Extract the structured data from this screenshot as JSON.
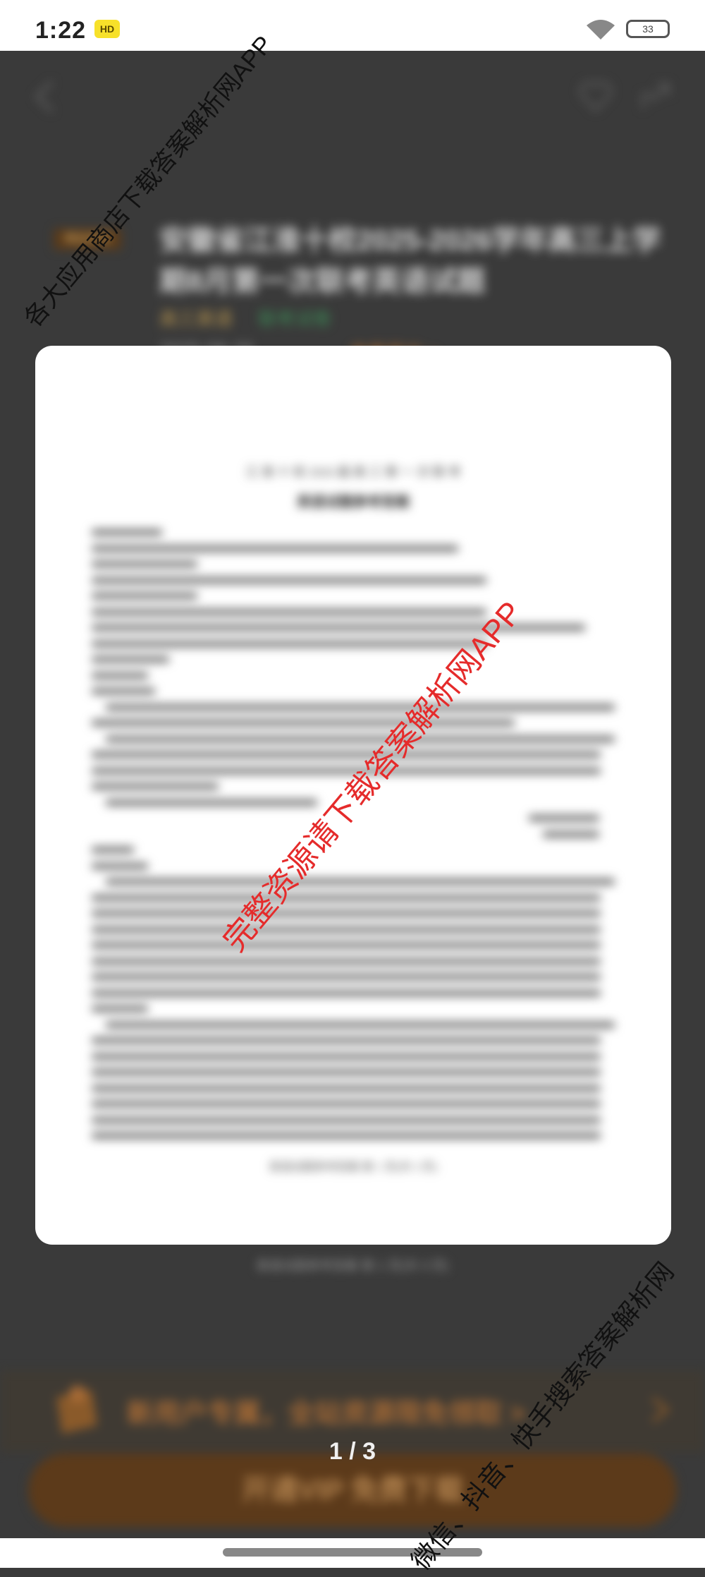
{
  "status_bar": {
    "time": "1:22",
    "badge": "HD",
    "battery": "33"
  },
  "header": {
    "tag": "精品资源",
    "title": "安徽省江淮十校2025-2026学年高三上学期8月第一次联考英语试题",
    "meta_grade": "高三英语",
    "meta_type": "联考试卷",
    "date": "2025-08-28",
    "link": "查看原文 >"
  },
  "preview": {
    "head": "江 淮 十 校 2026 届 高 三 第 一 次 联 考",
    "title": "英语试题参考答案",
    "footer": "英语试题参考答案  第 1 页(共 3 页)"
  },
  "page_footer": "英语试题参考答案  第 1 页(共 3 页)",
  "promo": {
    "text": "新用户专属，全站资源限免领取 >"
  },
  "cta": {
    "label": "开通VIP 免费下载"
  },
  "pager": {
    "current": "1",
    "total": "3",
    "display": "1 / 3"
  },
  "watermarks": {
    "top": "各大应用商店下载答案解析网APP",
    "center": "完整资源请下载答案解析网APP",
    "bottom": "微信、抖音、快手搜索答案解析网"
  },
  "colors": {
    "overlay": "#3a3a3a",
    "accent_brown": "#5c3a1a",
    "watermark_red": "#e52b2b"
  }
}
